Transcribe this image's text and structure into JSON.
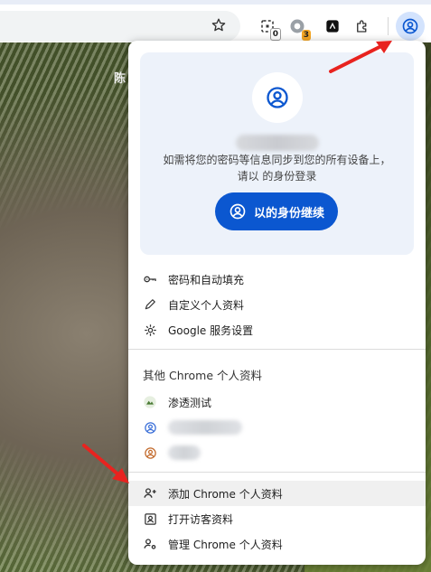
{
  "background": {
    "label": "陈"
  },
  "toolbar": {
    "star_icon": "star-icon",
    "extension1_badge": "0",
    "extension2_badge": "3",
    "accent": "#0b57d0"
  },
  "menu": {
    "sync_text_line1": "如需将您的密码等信息同步到您的所有设备上，",
    "sync_text_line2": "请以  的身份登录",
    "continue_label": "以的身份继续",
    "items": [
      {
        "label": "密码和自动填充",
        "icon": "key-icon"
      },
      {
        "label": "自定义个人资料",
        "icon": "pencil-icon"
      },
      {
        "label": "Google 服务设置",
        "icon": "gear-icon"
      }
    ],
    "other_profiles_title": "其他 Chrome 个人资料",
    "profiles": [
      {
        "label": "渗透测试"
      }
    ],
    "actions": [
      {
        "label": "添加 Chrome 个人资料",
        "icon": "add-person-icon"
      },
      {
        "label": "打开访客资料",
        "icon": "guest-icon"
      },
      {
        "label": "管理 Chrome 个人资料",
        "icon": "manage-profiles-icon"
      }
    ]
  }
}
